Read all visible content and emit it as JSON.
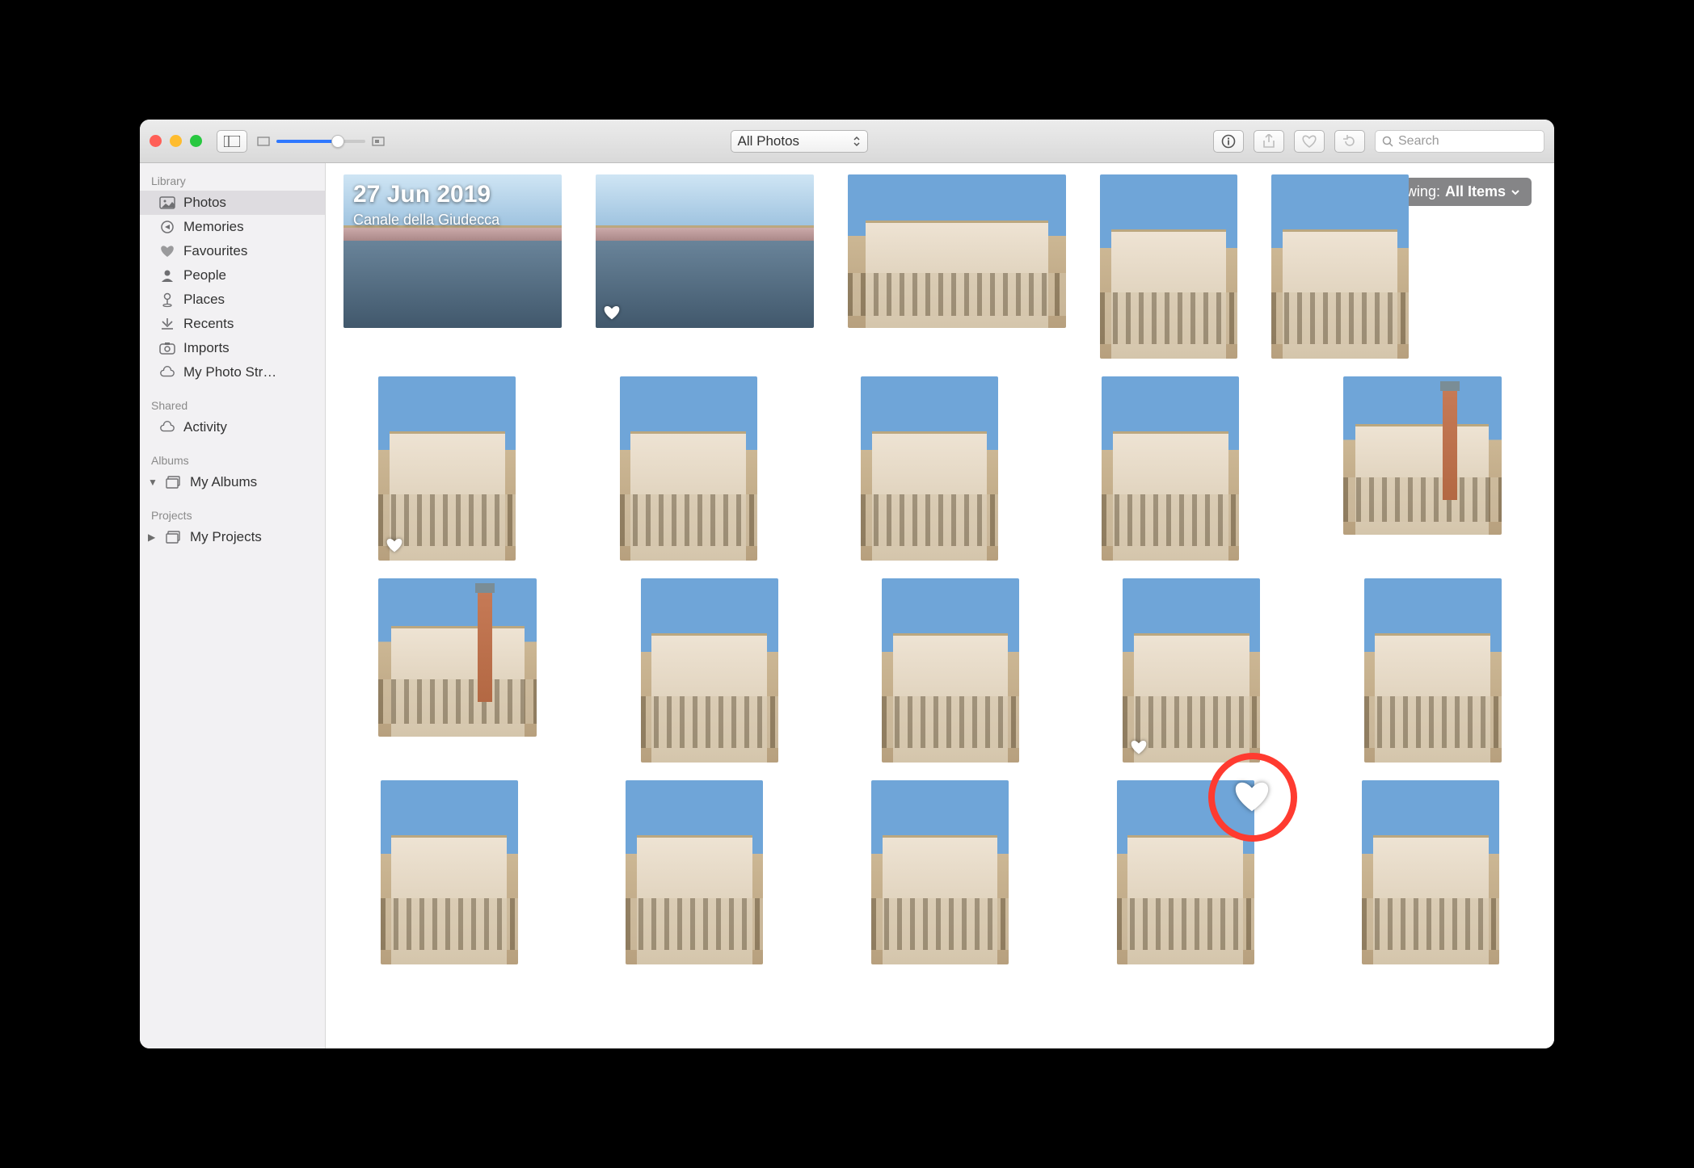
{
  "toolbar": {
    "filter_label": "All Photos",
    "search_placeholder": "Search"
  },
  "sidebar": {
    "sections": {
      "library": {
        "header": "Library",
        "items": [
          "Photos",
          "Memories",
          "Favourites",
          "People",
          "Places",
          "Recents",
          "Imports",
          "My Photo Str…"
        ]
      },
      "shared": {
        "header": "Shared",
        "items": [
          "Activity"
        ]
      },
      "albums": {
        "header": "Albums",
        "items": [
          "My Albums"
        ]
      },
      "projects": {
        "header": "Projects",
        "items": [
          "My Projects"
        ]
      }
    }
  },
  "header": {
    "date": "27 Jun 2019",
    "location": "Canale della Giudecca"
  },
  "showing": {
    "prefix": "Showing: ",
    "value": "All Items"
  },
  "photos": [
    {
      "shape": "wide",
      "variant": "canal",
      "fav": false
    },
    {
      "shape": "wide",
      "variant": "canal",
      "fav": true
    },
    {
      "shape": "wide",
      "variant": "palace",
      "fav": false
    },
    {
      "shape": "tall",
      "variant": "palace",
      "fav": false
    },
    {
      "shape": "tall",
      "variant": "palace",
      "fav": false
    },
    {
      "shape": "tall",
      "variant": "palace",
      "fav": true
    },
    {
      "shape": "tall",
      "variant": "palace",
      "fav": false
    },
    {
      "shape": "tall",
      "variant": "palace",
      "fav": false
    },
    {
      "shape": "tall",
      "variant": "palace",
      "fav": false
    },
    {
      "shape": "sq",
      "variant": "tower",
      "fav": false
    },
    {
      "shape": "sq",
      "variant": "tower",
      "fav": false
    },
    {
      "shape": "tall",
      "variant": "basilica",
      "fav": false
    },
    {
      "shape": "tall",
      "variant": "basilica",
      "fav": false
    },
    {
      "shape": "tall",
      "variant": "basilica",
      "fav": true
    },
    {
      "shape": "tall",
      "variant": "basilica",
      "fav": false
    },
    {
      "shape": "tall",
      "variant": "basilica",
      "fav": false
    },
    {
      "shape": "tall",
      "variant": "basilica",
      "fav": false
    },
    {
      "shape": "tall",
      "variant": "basilica",
      "fav": false
    },
    {
      "shape": "tall",
      "variant": "basilica",
      "fav": false
    },
    {
      "shape": "tall",
      "variant": "basilica",
      "fav": false
    }
  ]
}
